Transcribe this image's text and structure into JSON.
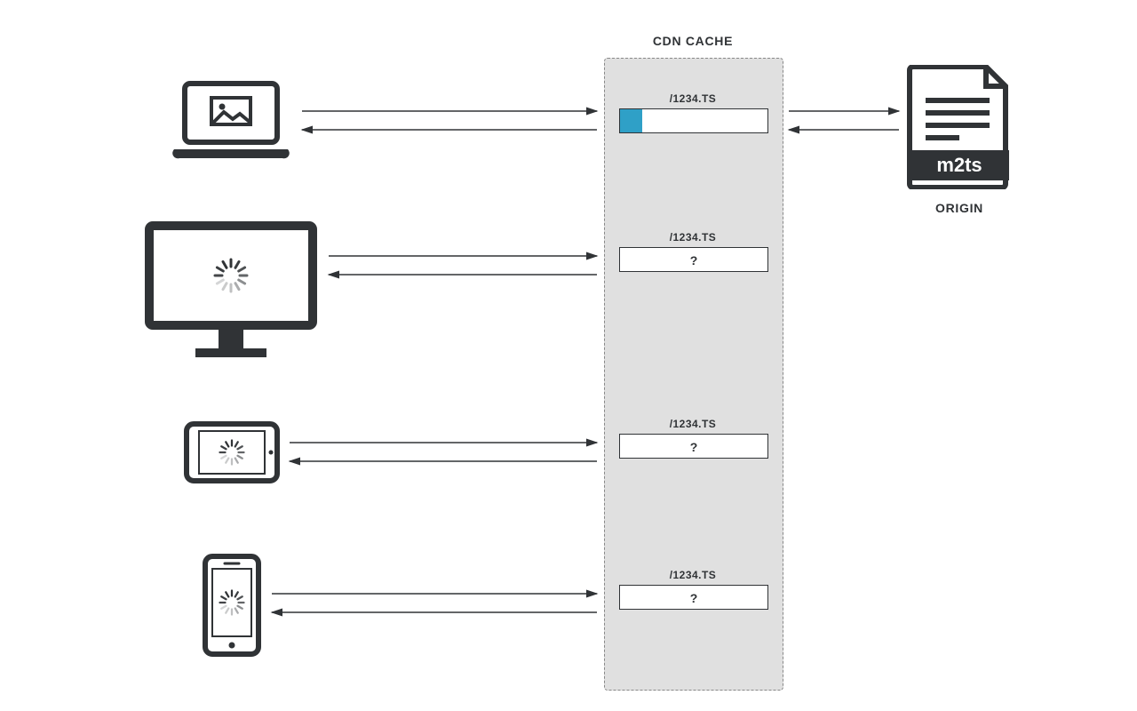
{
  "labels": {
    "cdn_cache": "CDN CACHE",
    "origin": "ORIGIN",
    "origin_file_ext": "m2ts"
  },
  "segments": [
    {
      "name": "/1234.TS",
      "progress_pct": 15,
      "state": "loading"
    },
    {
      "name": "/1234.TS",
      "progress_pct": 0,
      "state": "unknown",
      "placeholder": "?"
    },
    {
      "name": "/1234.TS",
      "progress_pct": 0,
      "state": "unknown",
      "placeholder": "?"
    },
    {
      "name": "/1234.TS",
      "progress_pct": 0,
      "state": "unknown",
      "placeholder": "?"
    }
  ],
  "devices": [
    {
      "kind": "laptop",
      "state": "image"
    },
    {
      "kind": "monitor",
      "state": "spinner"
    },
    {
      "kind": "tablet",
      "state": "spinner"
    },
    {
      "kind": "phone",
      "state": "spinner"
    }
  ],
  "colors": {
    "stroke": "#303336",
    "cache_bg": "#e0e0e0",
    "progress": "#2fa0c7"
  }
}
